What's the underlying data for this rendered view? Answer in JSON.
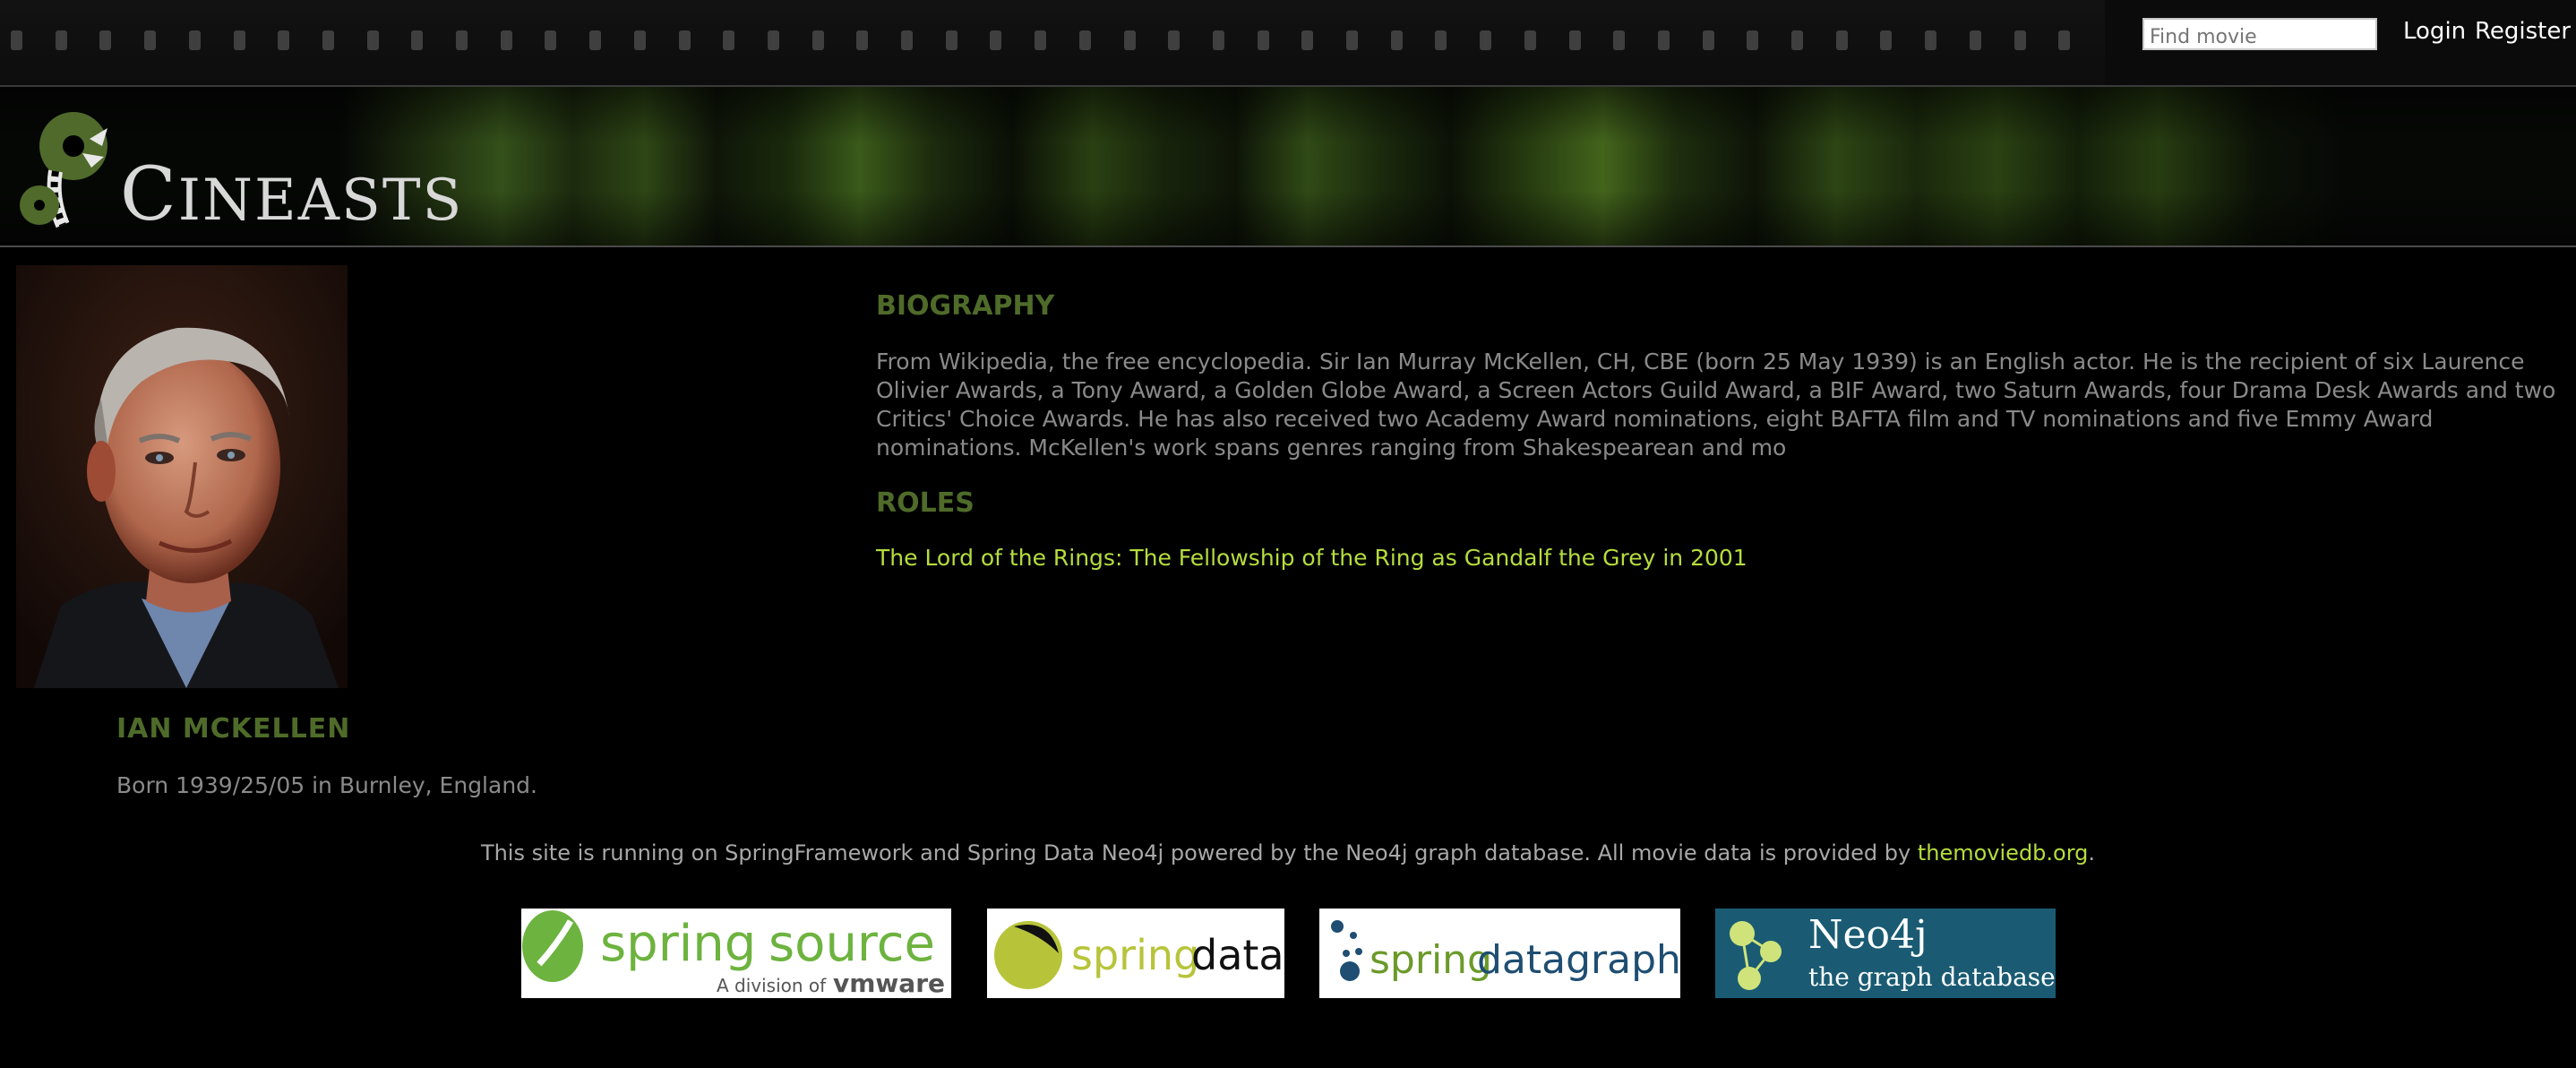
{
  "header": {
    "search_placeholder": "Find movie",
    "login_label": "Login",
    "register_label": "Register"
  },
  "logo": {
    "first_letter": "C",
    "rest": "INEASTS"
  },
  "actor": {
    "name": "IAN MCKELLEN",
    "born": "Born 1939/25/05 in Burnley, England."
  },
  "biography": {
    "title": "BIOGRAPHY",
    "text": "From Wikipedia, the free encyclopedia. Sir Ian Murray McKellen, CH, CBE (born 25 May 1939) is an English actor. He is the recipient of six Laurence Olivier Awards, a Tony Award, a Golden Globe Award, a Screen Actors Guild Award, a BIF Award, two Saturn Awards, four Drama Desk Awards and two Critics' Choice Awards. He has also received two Academy Award nominations, eight BAFTA film and TV nominations and five Emmy Award nominations. McKellen's work spans genres ranging from Shakespearean and mo"
  },
  "roles": {
    "title": "ROLES",
    "items": [
      {
        "label": "The Lord of the Rings: The Fellowship of the Ring as Gandalf the Grey in 2001"
      }
    ]
  },
  "footer": {
    "text_before": "This site is running on SpringFramework and Spring Data Neo4j powered by the Neo4j graph database. All movie data is provided by ",
    "link_label": "themoviedb.org",
    "text_after": "."
  },
  "sponsors": {
    "springsource": {
      "main_a": "spring",
      "main_b": "source",
      "tag_a": "A division of",
      "tag_b": "vmware"
    },
    "springdata": {
      "main_a": "spring",
      "main_b": "data"
    },
    "springdatagraph": {
      "main_a": "spring",
      "main_b": "datagraph"
    },
    "neo4j": {
      "line1": "Neo4j",
      "line2": "the graph database"
    }
  },
  "colors": {
    "accent_green": "#b5dd3e",
    "heading_green": "#4f6b29",
    "body_text": "#8a8a8a"
  }
}
